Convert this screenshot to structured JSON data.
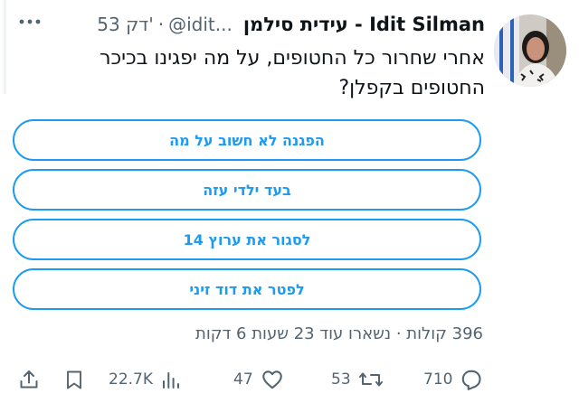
{
  "author": {
    "name": "עידית סילמן - Idit Silman",
    "handle": "@idit...",
    "separator": "·",
    "time": "53 דק'"
  },
  "tweet": {
    "text": "אחרי שחרור כל החטופים, על מה יפגינו בכיכר החטופים בקפלן?"
  },
  "poll": {
    "options": [
      "הפגנה לא חשוב על מה",
      "בעד ילדי עזה",
      "לסגור את ערוץ 14",
      "לפטר את דוד זיני"
    ],
    "meta": "396 קולות · נשארו עוד 23 שעות 6 דקות"
  },
  "actions": {
    "replies": "710",
    "retweets": "53",
    "likes": "47",
    "views": "22.7K"
  },
  "icons": {
    "more": "more-icon",
    "reply": "reply-icon",
    "retweet": "retweet-icon",
    "like": "heart-icon",
    "views": "views-icon",
    "bookmark": "bookmark-icon",
    "share": "share-icon"
  },
  "colors": {
    "accent": "#1d9bf0",
    "text": "#0f1419",
    "muted": "#536471"
  }
}
